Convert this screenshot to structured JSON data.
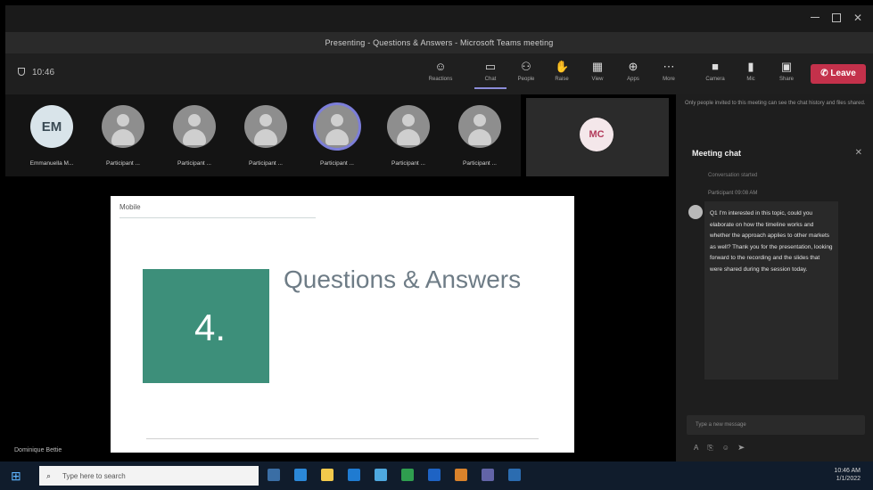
{
  "window": {
    "banner": "Presenting - Questions & Answers - Microsoft Teams meeting"
  },
  "toolbar": {
    "timer": "10:46",
    "buttons": [
      {
        "label": "Reactions",
        "icon": "smile-icon"
      },
      {
        "label": "Chat",
        "icon": "chat-icon"
      },
      {
        "label": "People",
        "icon": "people-icon"
      },
      {
        "label": "Raise",
        "icon": "hand-icon"
      },
      {
        "label": "View",
        "icon": "grid-icon"
      },
      {
        "label": "Apps",
        "icon": "apps-icon"
      },
      {
        "label": "More",
        "icon": "more-icon"
      },
      {
        "label": "Camera",
        "icon": "camera-icon"
      },
      {
        "label": "Mic",
        "icon": "mic-icon"
      },
      {
        "label": "Share",
        "icon": "share-icon"
      }
    ],
    "leave_label": "Leave"
  },
  "participants": [
    {
      "initials": "EM",
      "name": "Emmanuella M..."
    },
    {
      "initials": "",
      "name": "Participant ..."
    },
    {
      "initials": "",
      "name": "Participant ..."
    },
    {
      "initials": "",
      "name": "Participant ..."
    },
    {
      "initials": "",
      "name": "Participant ..."
    },
    {
      "initials": "",
      "name": "Participant ..."
    },
    {
      "initials": "",
      "name": "Participant ..."
    }
  ],
  "self": {
    "initials": "MC"
  },
  "slide": {
    "logo": "Mobile",
    "number": "4.",
    "title": "Questions & Answers"
  },
  "presenter_name": "Dominique Bettie",
  "chat": {
    "notice": "Only people invited to this meeting can see the chat history and files shared.",
    "title": "Meeting chat",
    "separator": "Conversation started",
    "meta": "Participant  09:08 AM",
    "message": "Q1 I'm interested in this topic, could you elaborate on how the timeline works and whether the approach applies to other markets as well? Thank you for the presentation, looking forward to the recording and the slides that were shared during the session today.",
    "compose_placeholder": "Type a new message"
  },
  "taskbar": {
    "search_placeholder": "Type here to search",
    "time": "10:46 AM",
    "date": "1/1/2022"
  },
  "colors": {
    "leave": "#c4314b",
    "slide_accent": "#3d8f7a",
    "active_tab": "#8b8cd8"
  }
}
